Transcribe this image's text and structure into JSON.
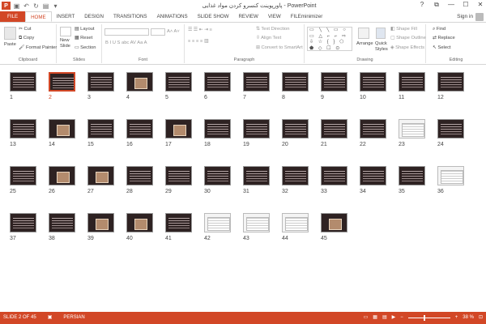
{
  "title": "پاورپوینت کنسرو کردن مواد غذایی - PowerPoint",
  "app_logo": "P",
  "qat": [
    "save-icon",
    "undo-icon",
    "redo-icon",
    "start-icon",
    "customize-icon"
  ],
  "window_controls": [
    "?",
    "⧉",
    "—",
    "☐",
    "✕"
  ],
  "tabs": [
    "FILE",
    "HOME",
    "INSERT",
    "DESIGN",
    "TRANSITIONS",
    "ANIMATIONS",
    "SLIDE SHOW",
    "REVIEW",
    "VIEW",
    "FILEminimizer"
  ],
  "active_tab": "HOME",
  "sign_in": "Sign in",
  "ribbon": {
    "clipboard": {
      "paste": "Paste",
      "cut": "Cut",
      "copy": "Copy",
      "format_painter": "Format Painter",
      "label": "Clipboard"
    },
    "slides": {
      "new_slide": "New",
      "new_slide2": "Slide",
      "layout": "Layout",
      "reset": "Reset",
      "section": "Section",
      "label": "Slides"
    },
    "font": {
      "label": "Font",
      "buttons": "B  I  U  S  abc  AV  Aa  A"
    },
    "paragraph": {
      "text_direction": "Text Direction",
      "align_text": "Align Text",
      "convert": "Convert to SmartArt",
      "label": "Paragraph"
    },
    "drawing": {
      "arrange": "Arrange",
      "quick_styles": "Quick",
      "quick_styles2": "Styles",
      "shape_fill": "Shape Fill",
      "shape_outline": "Shape Outline",
      "shape_effects": "Shape Effects",
      "shapes": "▭ ╲ ╲ ▭ ○ ▭ △\n⌐ ⌐ ⇨ ⇩ ☆ { }\n⬠ ⬟ ◇ ☐ ⊙",
      "label": "Drawing"
    },
    "editing": {
      "find": "Find",
      "replace": "Replace",
      "select": "Select",
      "label": "Editing"
    }
  },
  "slides": [
    {
      "n": "1",
      "kind": "dark"
    },
    {
      "n": "2",
      "kind": "dark",
      "selected": true
    },
    {
      "n": "3",
      "kind": "dark"
    },
    {
      "n": "4",
      "kind": "photo"
    },
    {
      "n": "5",
      "kind": "dark"
    },
    {
      "n": "6",
      "kind": "dark"
    },
    {
      "n": "7",
      "kind": "dark"
    },
    {
      "n": "8",
      "kind": "dark"
    },
    {
      "n": "9",
      "kind": "dark"
    },
    {
      "n": "10",
      "kind": "dark"
    },
    {
      "n": "11",
      "kind": "dark"
    },
    {
      "n": "12",
      "kind": "dark"
    },
    {
      "n": "13",
      "kind": "dark"
    },
    {
      "n": "14",
      "kind": "photo"
    },
    {
      "n": "15",
      "kind": "dark"
    },
    {
      "n": "16",
      "kind": "dark"
    },
    {
      "n": "17",
      "kind": "photo"
    },
    {
      "n": "18",
      "kind": "dark"
    },
    {
      "n": "19",
      "kind": "dark"
    },
    {
      "n": "20",
      "kind": "dark"
    },
    {
      "n": "21",
      "kind": "dark"
    },
    {
      "n": "22",
      "kind": "dark"
    },
    {
      "n": "23",
      "kind": "light"
    },
    {
      "n": "24",
      "kind": "dark"
    },
    {
      "n": "25",
      "kind": "dark"
    },
    {
      "n": "26",
      "kind": "photo"
    },
    {
      "n": "27",
      "kind": "photo"
    },
    {
      "n": "28",
      "kind": "dark"
    },
    {
      "n": "29",
      "kind": "dark"
    },
    {
      "n": "30",
      "kind": "dark"
    },
    {
      "n": "31",
      "kind": "dark"
    },
    {
      "n": "32",
      "kind": "dark"
    },
    {
      "n": "33",
      "kind": "dark"
    },
    {
      "n": "34",
      "kind": "dark"
    },
    {
      "n": "35",
      "kind": "dark"
    },
    {
      "n": "36",
      "kind": "light"
    },
    {
      "n": "37",
      "kind": "dark"
    },
    {
      "n": "38",
      "kind": "dark"
    },
    {
      "n": "39",
      "kind": "photo"
    },
    {
      "n": "40",
      "kind": "photo"
    },
    {
      "n": "41",
      "kind": "dark"
    },
    {
      "n": "42",
      "kind": "light"
    },
    {
      "n": "43",
      "kind": "light"
    },
    {
      "n": "44",
      "kind": "light"
    },
    {
      "n": "45",
      "kind": "photo"
    }
  ],
  "status": {
    "slide_info": "SLIDE 2 OF 45",
    "language": "PERSIAN",
    "zoom": "38 %",
    "zoom_level": 0.38
  },
  "colors": {
    "accent": "#d24726"
  }
}
